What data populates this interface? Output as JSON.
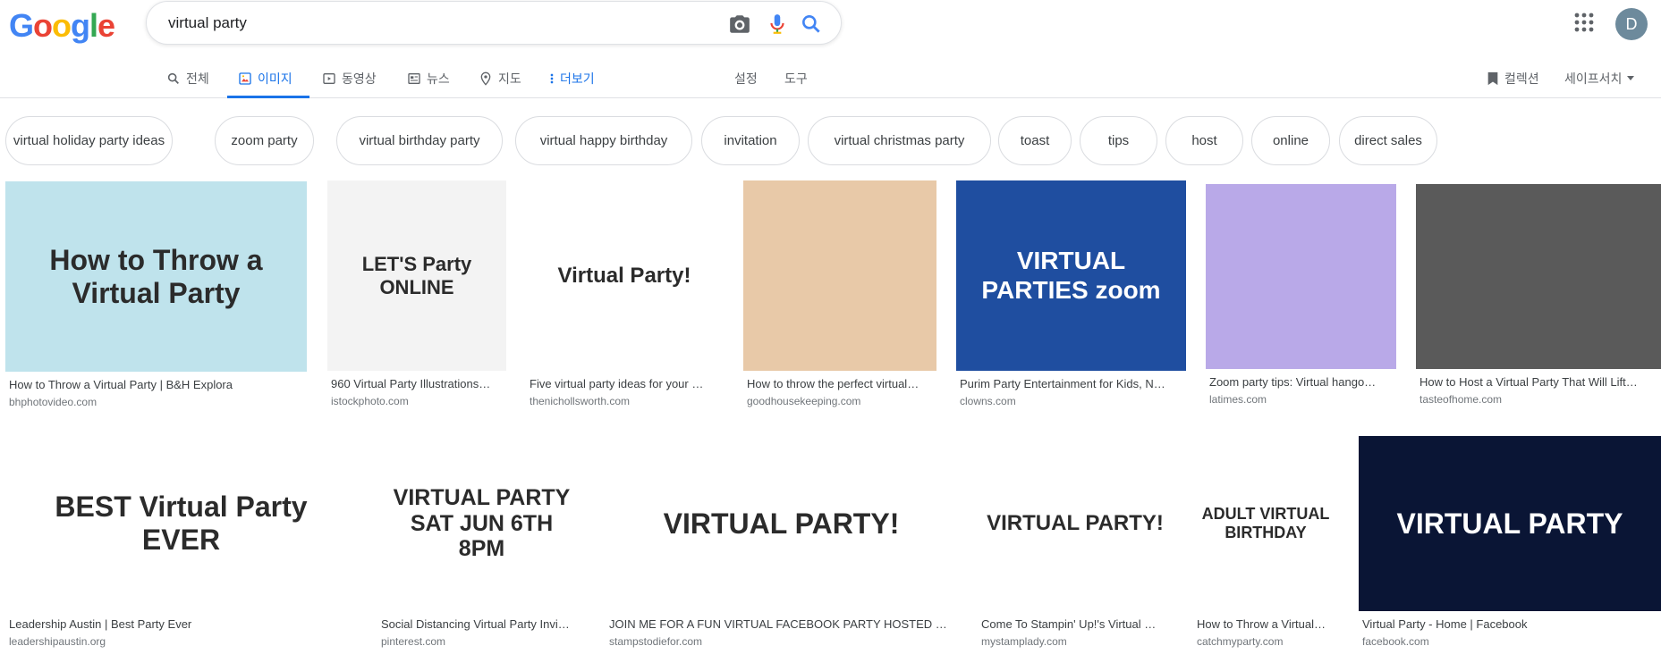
{
  "logo": [
    "G",
    "o",
    "o",
    "g",
    "l",
    "e"
  ],
  "logo_colors": [
    "#4285F4",
    "#EA4335",
    "#FBBC05",
    "#4285F4",
    "#34A853",
    "#EA4335"
  ],
  "search": {
    "query": "virtual party"
  },
  "user": {
    "initial": "D"
  },
  "tabs": [
    {
      "label": "전체",
      "icon": "search-icon"
    },
    {
      "label": "이미지",
      "icon": "image-icon",
      "active": true
    },
    {
      "label": "동영상",
      "icon": "video-icon"
    },
    {
      "label": "뉴스",
      "icon": "news-icon"
    },
    {
      "label": "지도",
      "icon": "map-pin-icon"
    },
    {
      "label": "더보기",
      "icon": "more-vert-icon"
    }
  ],
  "tools": {
    "settings": "설정",
    "tools": "도구",
    "collections": "컬렉션",
    "safesearch": "세이프서치"
  },
  "chips": [
    "virtual holiday party ideas",
    "zoom party",
    "virtual birthday party",
    "virtual happy birthday",
    "invitation",
    "virtual christmas party",
    "toast",
    "tips",
    "host",
    "online",
    "direct sales"
  ],
  "row1": [
    {
      "title": "How to Throw a Virtual Party | B&H Explora",
      "source": "bhphotovideo.com",
      "text": "How to Throw a Virtual Party",
      "bg": "#bfe3ec"
    },
    {
      "title": "960 Virtual Party Illustrations…",
      "source": "istockphoto.com",
      "text": "LET'S Party ONLINE",
      "bg": "#f3f3f3"
    },
    {
      "title": "Five virtual party ideas for your …",
      "source": "thenichollsworth.com",
      "text": "Virtual Party!",
      "bg": "#ffffff"
    },
    {
      "title": "How to throw the perfect virtual…",
      "source": "goodhousekeeping.com",
      "text": "",
      "bg": "#e8c9a8"
    },
    {
      "title": "Purim Party Entertainment for Kids, N…",
      "source": "clowns.com",
      "text": "VIRTUAL PARTIES zoom",
      "bg": "#1f4ea0"
    },
    {
      "title": "Zoom party tips: Virtual hango…",
      "source": "latimes.com",
      "text": "",
      "bg": "#b9a9e8"
    },
    {
      "title": "How to Host a Virtual Party That Will Lift…",
      "source": "tasteofhome.com",
      "text": "",
      "bg": "#5a5a5a"
    }
  ],
  "row2": [
    {
      "title": "Leadership Austin | Best Party Ever",
      "source": "leadershipaustin.org",
      "text": "BEST Virtual Party EVER",
      "bg": "#ffffff"
    },
    {
      "title": "Social Distancing Virtual Party Invi…",
      "source": "pinterest.com",
      "text": "VIRTUAL PARTY SAT JUN 6TH 8PM",
      "bg": "#ffffff"
    },
    {
      "title": "JOIN ME FOR A FUN VIRTUAL FACEBOOK PARTY HOSTED B…",
      "source": "stampstodiefor.com",
      "text": "VIRTUAL PARTY!",
      "bg": "#ffffff"
    },
    {
      "title": "Come To Stampin' Up!'s Virtual …",
      "source": "mystamplady.com",
      "text": "VIRTUAL PARTY!",
      "bg": "#ffffff"
    },
    {
      "title": "How to Throw a Virtual…",
      "source": "catchmyparty.com",
      "text": "ADULT VIRTUAL BIRTHDAY",
      "bg": "#ffffff"
    },
    {
      "title": "Virtual Party - Home | Facebook",
      "source": "facebook.com",
      "text": "VIRTUAL PARTY",
      "bg": "#0a1535"
    }
  ]
}
